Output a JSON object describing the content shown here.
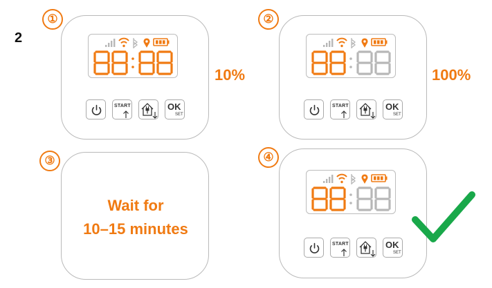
{
  "figure_label": "2",
  "colors": {
    "accent": "#f07a12",
    "check": "#19a84a",
    "dim": "#b7b7b7",
    "frame": "#b9b9b9"
  },
  "steps": [
    {
      "number": "①",
      "progress": "10%"
    },
    {
      "number": "②",
      "progress": "100%"
    },
    {
      "number": "③",
      "wait_line1": "Wait for",
      "wait_line2": "10–15 minutes"
    },
    {
      "number": "④"
    }
  ],
  "buttons": {
    "start_label": "START",
    "ok_label": "OK",
    "set_label": "SET"
  },
  "icons": [
    "signal-bars-icon",
    "wifi-icon",
    "bluetooth-icon",
    "location-pin-icon",
    "battery-icon",
    "power-icon",
    "arrow-up-icon",
    "house-plug-icon",
    "arrow-down-icon",
    "checkmark-icon"
  ]
}
